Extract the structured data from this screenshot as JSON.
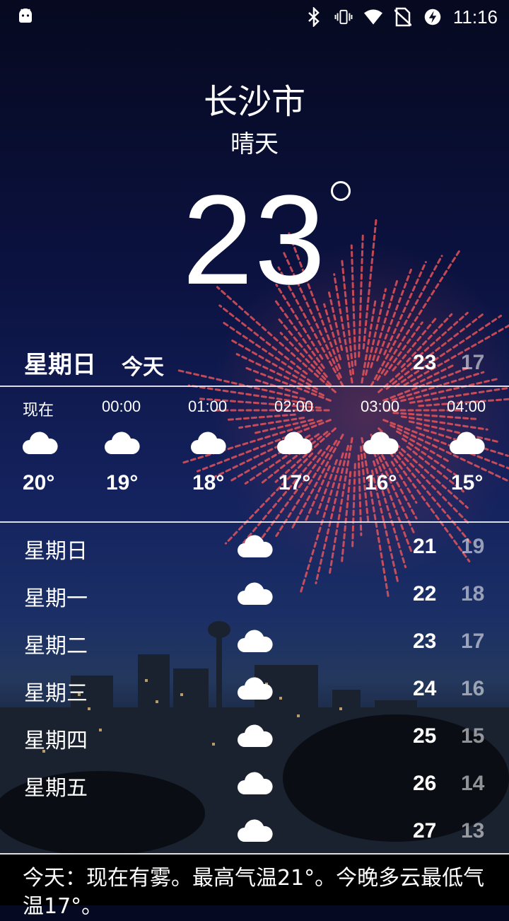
{
  "status_bar": {
    "time": "11:16",
    "icons": [
      "android-icon",
      "bluetooth-icon",
      "vibrate-icon",
      "wifi-icon",
      "no-sim-icon",
      "battery-saver-icon"
    ]
  },
  "city": "长沙市",
  "condition": "晴天",
  "current_temp": "23",
  "today": {
    "day": "星期日",
    "label": "今天",
    "high": "23",
    "low": "17"
  },
  "hourly": [
    {
      "time": "现在",
      "temp": "20°",
      "icon": "cloud-icon"
    },
    {
      "time": "00:00",
      "temp": "19°",
      "icon": "cloud-icon"
    },
    {
      "time": "01:00",
      "temp": "18°",
      "icon": "cloud-icon"
    },
    {
      "time": "02:00",
      "temp": "17°",
      "icon": "cloud-icon"
    },
    {
      "time": "03:00",
      "temp": "16°",
      "icon": "cloud-icon"
    },
    {
      "time": "04:00",
      "temp": "15°",
      "icon": "cloud-icon"
    }
  ],
  "daily": [
    {
      "day": "星期日",
      "high": "21",
      "low": "19",
      "icon": "cloud-icon"
    },
    {
      "day": "星期一",
      "high": "22",
      "low": "18",
      "icon": "cloud-icon"
    },
    {
      "day": "星期二",
      "high": "23",
      "low": "17",
      "icon": "cloud-icon"
    },
    {
      "day": "星期三",
      "high": "24",
      "low": "16",
      "icon": "cloud-icon"
    },
    {
      "day": "星期四",
      "high": "25",
      "low": "15",
      "icon": "cloud-icon"
    },
    {
      "day": "星期五",
      "high": "26",
      "low": "14",
      "icon": "cloud-icon"
    },
    {
      "day": "",
      "high": "27",
      "low": "13",
      "icon": "cloud-icon"
    }
  ],
  "summary": "今天：现在有雾。最高气温21°。今晚多云最低气温17°。"
}
